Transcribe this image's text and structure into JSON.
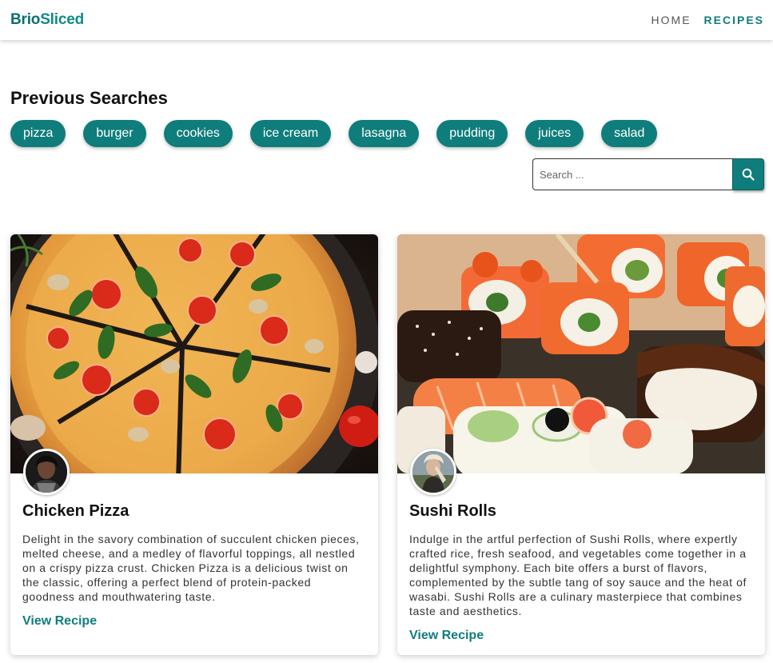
{
  "header": {
    "brand_part1": "Brio",
    "brand_part2": "Sliced",
    "nav": [
      {
        "label": "HOME",
        "active": false
      },
      {
        "label": "RECIPES",
        "active": true
      }
    ]
  },
  "previous_searches": {
    "title": "Previous Searches",
    "chips": [
      "pizza",
      "burger",
      "cookies",
      "ice cream",
      "lasagna",
      "pudding",
      "juices",
      "salad"
    ]
  },
  "search": {
    "placeholder": "Search ...",
    "value": "",
    "button_icon": "search-icon"
  },
  "cards": [
    {
      "title": "Chicken Pizza",
      "description": "Delight in the savory combination of succulent chicken pieces, melted cheese, and a medley of flavorful toppings, all nestled on a crispy pizza crust. Chicken Pizza is a delicious twist on the classic, offering a perfect blend of protein-packed goodness and mouthwatering taste.",
      "link": "View Recipe"
    },
    {
      "title": "Sushi Rolls",
      "description": "Indulge in the artful perfection of Sushi Rolls, where expertly crafted rice, fresh seafood, and vegetables come together in a delightful symphony. Each bite offers a burst of flavors, complemented by the subtle tang of soy sauce and the heat of wasabi. Sushi Rolls are a culinary masterpiece that combines taste and aesthetics.",
      "link": "View Recipe"
    }
  ],
  "colors": {
    "accent": "#0f7d7b",
    "brand_dark": "#0b6f6f"
  }
}
